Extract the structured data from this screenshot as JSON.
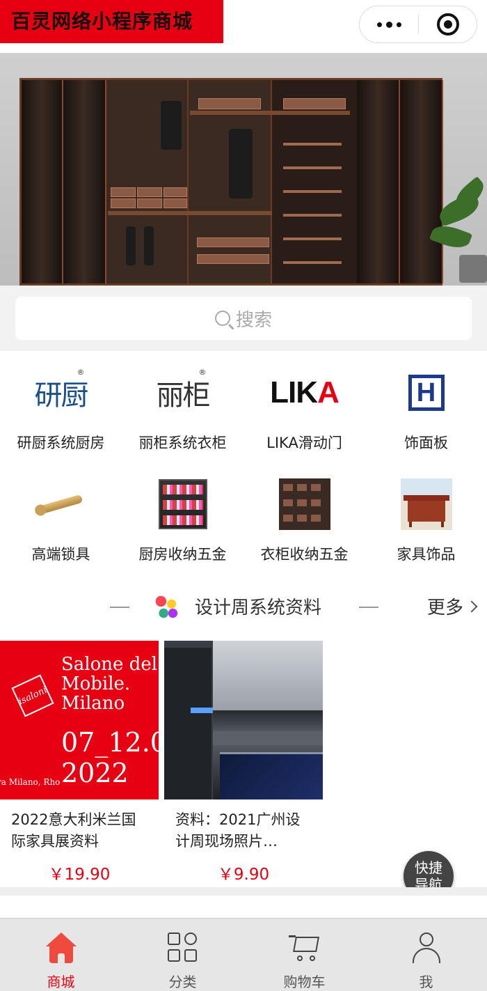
{
  "header": {
    "app_title": "百灵网络小程序商城",
    "capsule_more_icon": "more-dots-icon",
    "capsule_close_icon": "close-circle-icon"
  },
  "search": {
    "placeholder": "搜索",
    "icon": "search-icon"
  },
  "categories": [
    {
      "label": "研厨系统厨房",
      "icon": "yanchu-logo-icon"
    },
    {
      "label": "丽柜系统衣柜",
      "icon": "ligui-logo-icon"
    },
    {
      "label": "LIKA滑动门",
      "icon": "lika-logo-icon"
    },
    {
      "label": "饰面板",
      "icon": "h-logo-icon"
    },
    {
      "label": "高端锁具",
      "icon": "door-handle-icon"
    },
    {
      "label": "厨房收纳五金",
      "icon": "kitchen-rack-icon"
    },
    {
      "label": "衣柜收纳五金",
      "icon": "wardrobe-drawer-icon"
    },
    {
      "label": "家具饰品",
      "icon": "cabinet-icon"
    }
  ],
  "logos": {
    "yanchu": "研厨",
    "ligui": "丽柜",
    "lika_prefix": "LIK",
    "lika_suffix": "A",
    "h": "H",
    "registered": "®"
  },
  "section": {
    "title": "设计周系统资料",
    "more": "更多"
  },
  "products": [
    {
      "name": "2022意大利米兰国际家具展资料",
      "price": "￥19.90",
      "image_text": {
        "title": "Salone del Mobile. Milano",
        "badge": "isaloni",
        "date": "07_12.0",
        "year": "2022",
        "location": "ra Milano, Rho"
      }
    },
    {
      "name": "资料：2021广州设计周现场照片…",
      "price": "￥9.90"
    }
  ],
  "quick_nav": "快捷导航",
  "tabbar": [
    {
      "label": "商城",
      "icon": "home-icon",
      "active": true
    },
    {
      "label": "分类",
      "icon": "category-grid-icon",
      "active": false
    },
    {
      "label": "购物车",
      "icon": "cart-icon",
      "active": false
    },
    {
      "label": "我",
      "icon": "user-icon",
      "active": false
    }
  ],
  "colors": {
    "brand_red": "#e60012",
    "tab_active": "#f04a3e"
  }
}
